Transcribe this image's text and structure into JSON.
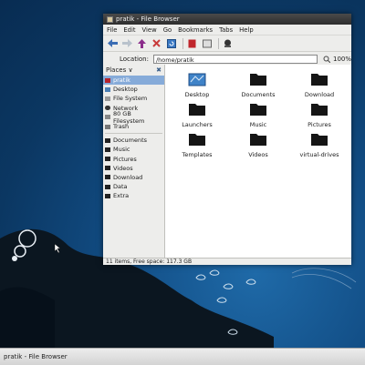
{
  "window": {
    "title": "pratik - File Browser"
  },
  "menu": [
    "File",
    "Edit",
    "View",
    "Go",
    "Bookmarks",
    "Tabs",
    "Help"
  ],
  "location": {
    "label": "Location:",
    "value": "/home/pratik",
    "zoom": "100%"
  },
  "sidebar": {
    "header": "Places",
    "items": [
      {
        "label": "pratik",
        "icon": "home-icon",
        "selected": true
      },
      {
        "label": "Desktop",
        "icon": "desktop-icon"
      },
      {
        "label": "File System",
        "icon": "drive-icon"
      },
      {
        "label": "Network",
        "icon": "network-icon"
      },
      {
        "label": "80 GB Filesystem",
        "icon": "drive-icon"
      },
      {
        "label": "Trash",
        "icon": "trash-icon"
      }
    ],
    "bookmarks": [
      "Documents",
      "Music",
      "Pictures",
      "Videos",
      "Download",
      "Data",
      "Extra"
    ]
  },
  "files": [
    {
      "name": "Desktop",
      "icon": "desktop-folder-icon"
    },
    {
      "name": "Documents",
      "icon": "folder-icon"
    },
    {
      "name": "Download",
      "icon": "folder-icon"
    },
    {
      "name": "Launchers",
      "icon": "folder-icon"
    },
    {
      "name": "Music",
      "icon": "folder-icon"
    },
    {
      "name": "Pictures",
      "icon": "folder-icon"
    },
    {
      "name": "Templates",
      "icon": "folder-icon"
    },
    {
      "name": "Videos",
      "icon": "folder-icon"
    },
    {
      "name": "virtual-drives",
      "icon": "folder-icon"
    }
  ],
  "status": "11 items, Free space: 117.3 GB",
  "taskbar": {
    "task": "pratik - File Browser"
  }
}
